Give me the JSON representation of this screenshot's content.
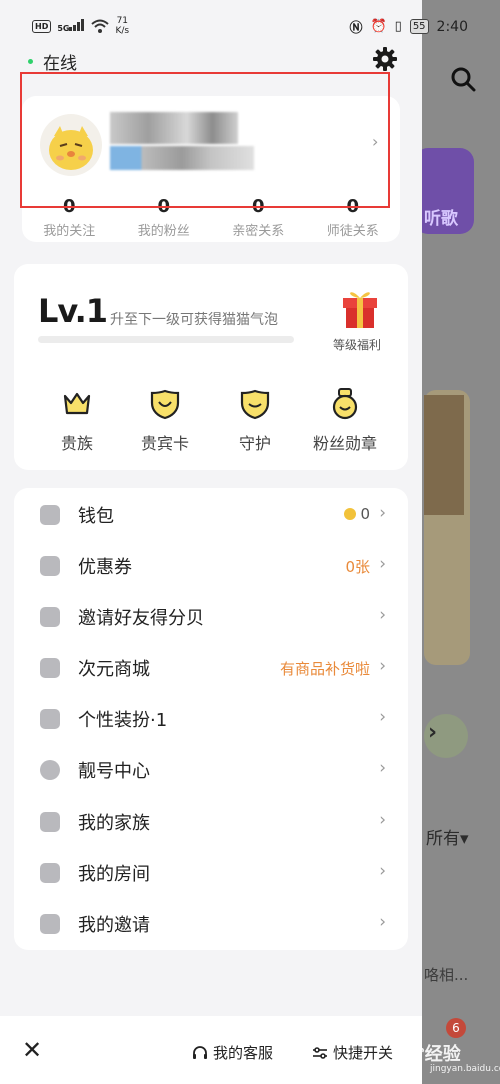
{
  "status_bar": {
    "hd": "HD",
    "signal": "5G",
    "speed_value": "71",
    "speed_unit": "K/s",
    "battery": "55",
    "time": "2:40"
  },
  "online_label": "在线",
  "profile": {
    "stats": [
      {
        "value": "0",
        "label": "我的关注"
      },
      {
        "value": "0",
        "label": "我的粉丝"
      },
      {
        "value": "0",
        "label": "亲密关系"
      },
      {
        "value": "0",
        "label": "师徒关系"
      }
    ]
  },
  "level": {
    "badge": "Lv.1",
    "description": "升至下一级可获得猫猫气泡",
    "progress": 0,
    "gift_label": "等级福利"
  },
  "privileges": [
    {
      "label": "贵族",
      "icon": "crown-icon"
    },
    {
      "label": "贵宾卡",
      "icon": "vip-shield-icon"
    },
    {
      "label": "守护",
      "icon": "guard-shield-icon"
    },
    {
      "label": "粉丝勋章",
      "icon": "fan-medal-icon"
    }
  ],
  "menu": [
    {
      "label": "钱包",
      "right": "0",
      "icon": "wallet-icon"
    },
    {
      "label": "优惠券",
      "right": "0张",
      "icon": "coupon-icon"
    },
    {
      "label": "邀请好友得分贝",
      "right": "",
      "icon": "invite-icon"
    },
    {
      "label": "次元商城",
      "right": "有商品补货啦",
      "icon": "shop-icon"
    },
    {
      "label": "个性装扮·1",
      "right": "",
      "icon": "shirt-icon"
    },
    {
      "label": "靓号中心",
      "right": "",
      "icon": "liang-icon"
    },
    {
      "label": "我的家族",
      "right": "",
      "icon": "family-icon"
    },
    {
      "label": "我的房间",
      "right": "",
      "icon": "home-icon"
    },
    {
      "label": "我的邀请",
      "right": "",
      "icon": "invitation-icon"
    }
  ],
  "bottom": {
    "customer_service": "我的客服",
    "shortcut": "快捷开关"
  },
  "background": {
    "music_label": "听歌",
    "all_label": "所有",
    "partial_text": "咯相...",
    "badge_count": "6"
  },
  "watermark": {
    "text": "经验",
    "sub": "jingyan.baidu.com"
  },
  "colors": {
    "accent_orange": "#e98a3a",
    "online_green": "#2fd16b",
    "highlight_red": "#e83a36",
    "gift_red": "#e9433c"
  }
}
